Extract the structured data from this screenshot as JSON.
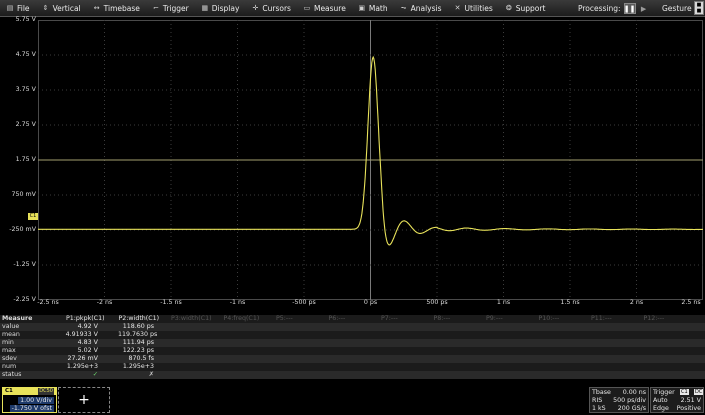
{
  "menu": {
    "items": [
      {
        "label": "File",
        "icon": "file-icon"
      },
      {
        "label": "Vertical",
        "icon": "vertical-icon"
      },
      {
        "label": "Timebase",
        "icon": "timebase-icon"
      },
      {
        "label": "Trigger",
        "icon": "trigger-icon"
      },
      {
        "label": "Display",
        "icon": "display-icon"
      },
      {
        "label": "Cursors",
        "icon": "cursors-icon"
      },
      {
        "label": "Measure",
        "icon": "measure-icon"
      },
      {
        "label": "Math",
        "icon": "math-icon"
      },
      {
        "label": "Analysis",
        "icon": "analysis-icon"
      },
      {
        "label": "Utilities",
        "icon": "utilities-icon"
      },
      {
        "label": "Support",
        "icon": "support-icon"
      }
    ],
    "processing_label": "Processing:",
    "gesture_label": "Gesture"
  },
  "grid": {
    "y_labels": [
      "5.75 V",
      "4.75 V",
      "3.75 V",
      "2.75 V",
      "1.75 V",
      "750 mV",
      "-250 mV",
      "-1.25 V",
      "-2.25 V"
    ],
    "x_labels": [
      "-2.5 ns",
      "-2 ns",
      "-1.5 ns",
      "-1 ns",
      "-500 ps",
      "0 ps",
      "500 ps",
      "1 ns",
      "1.5 ns",
      "2 ns",
      "2.5 ns"
    ],
    "channel_marker": "C1",
    "trace_color": "#e8e25a"
  },
  "measure": {
    "title": "Measure",
    "params": [
      {
        "label": "P1:pkpk(C1)",
        "active": true
      },
      {
        "label": "P2:width(C1)",
        "active": true
      },
      {
        "label": "P3:width(C1)",
        "active": false
      },
      {
        "label": "P4:freq(C1)",
        "active": false
      },
      {
        "label": "P5:---",
        "active": false
      },
      {
        "label": "P6:---",
        "active": false
      },
      {
        "label": "P7:---",
        "active": false
      },
      {
        "label": "P8:---",
        "active": false
      },
      {
        "label": "P9:---",
        "active": false
      },
      {
        "label": "P10:---",
        "active": false
      },
      {
        "label": "P11:---",
        "active": false
      },
      {
        "label": "P12:---",
        "active": false
      }
    ],
    "rows": [
      {
        "name": "value",
        "p1": "4.92 V",
        "p2": "118.60 ps"
      },
      {
        "name": "mean",
        "p1": "4.91933 V",
        "p2": "119.7630 ps"
      },
      {
        "name": "min",
        "p1": "4.83 V",
        "p2": "111.94 ps"
      },
      {
        "name": "max",
        "p1": "5.02 V",
        "p2": "122.23 ps"
      },
      {
        "name": "sdev",
        "p1": "27.26 mV",
        "p2": "870.5 fs"
      },
      {
        "name": "num",
        "p1": "1.295e+3",
        "p2": "1.295e+3"
      },
      {
        "name": "status",
        "p1": "✓",
        "p2": "✗"
      }
    ]
  },
  "channel": {
    "label": "C1",
    "coupling": "DC50",
    "vdiv": "1.00 V/div",
    "offset": "-1.750 V ofst"
  },
  "add_button": "+",
  "timebase": {
    "title": "Tbase",
    "delay": "0.00 ns",
    "mode": "RIS",
    "tdiv": "500 ps/div",
    "samples": "1 kS",
    "rate": "200 GS/s"
  },
  "trigger": {
    "title": "Trigger",
    "tag1": "C1",
    "tag2": "DC",
    "mode": "Auto",
    "level": "2.51 V",
    "type": "Edge",
    "slope": "Positive"
  }
}
